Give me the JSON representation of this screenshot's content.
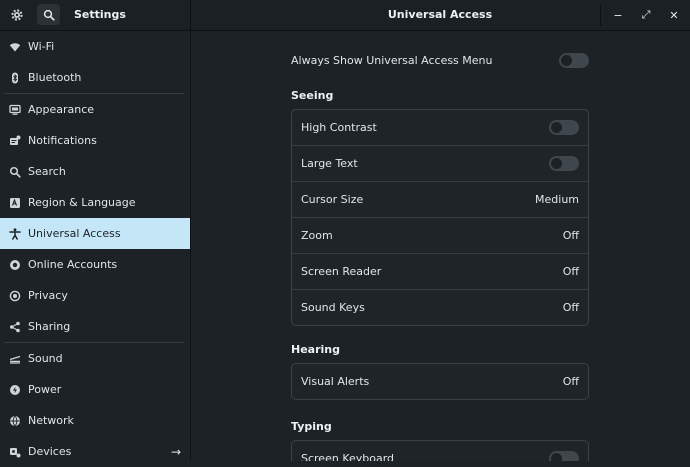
{
  "header": {
    "app_title": "Settings",
    "page_title": "Universal Access",
    "icons": [
      "gear-icon",
      "search-icon",
      "minimize-icon",
      "maximize-icon",
      "close-icon"
    ],
    "minimize_glyph": "−",
    "maximize_glyph": "⤢",
    "close_glyph": "✕"
  },
  "sidebar": {
    "items": [
      {
        "label": "Wi-Fi",
        "icon": "wifi-icon"
      },
      {
        "label": "Bluetooth",
        "icon": "bluetooth-icon"
      },
      {
        "label": "Appearance",
        "icon": "appearance-icon"
      },
      {
        "label": "Notifications",
        "icon": "notifications-icon"
      },
      {
        "label": "Search",
        "icon": "search-icon"
      },
      {
        "label": "Region & Language",
        "icon": "region-icon"
      },
      {
        "label": "Universal Access",
        "icon": "accessibility-icon",
        "active": true
      },
      {
        "label": "Online Accounts",
        "icon": "online-accounts-icon"
      },
      {
        "label": "Privacy",
        "icon": "privacy-icon"
      },
      {
        "label": "Sharing",
        "icon": "sharing-icon"
      },
      {
        "label": "Sound",
        "icon": "sound-icon"
      },
      {
        "label": "Power",
        "icon": "power-icon"
      },
      {
        "label": "Network",
        "icon": "network-icon"
      },
      {
        "label": "Devices",
        "icon": "devices-icon",
        "arrow": "→"
      }
    ]
  },
  "main": {
    "always_show": {
      "label": "Always Show Universal Access Menu",
      "enabled": false
    },
    "seeing": {
      "title": "Seeing",
      "rows": [
        {
          "label": "High Contrast",
          "type": "toggle",
          "enabled": false
        },
        {
          "label": "Large Text",
          "type": "toggle",
          "enabled": false
        },
        {
          "label": "Cursor Size",
          "type": "value",
          "value": "Medium"
        },
        {
          "label": "Zoom",
          "type": "value",
          "value": "Off"
        },
        {
          "label": "Screen Reader",
          "type": "value",
          "value": "Off"
        },
        {
          "label": "Sound Keys",
          "type": "value",
          "value": "Off"
        }
      ]
    },
    "hearing": {
      "title": "Hearing",
      "rows": [
        {
          "label": "Visual Alerts",
          "type": "value",
          "value": "Off"
        }
      ]
    },
    "typing": {
      "title": "Typing",
      "rows": [
        {
          "label": "Screen Keyboard",
          "type": "toggle",
          "enabled": false
        }
      ]
    }
  },
  "colors": {
    "accent": "#c5e6f6",
    "background": "#1d2227",
    "toggle_off": "#3f464c"
  }
}
